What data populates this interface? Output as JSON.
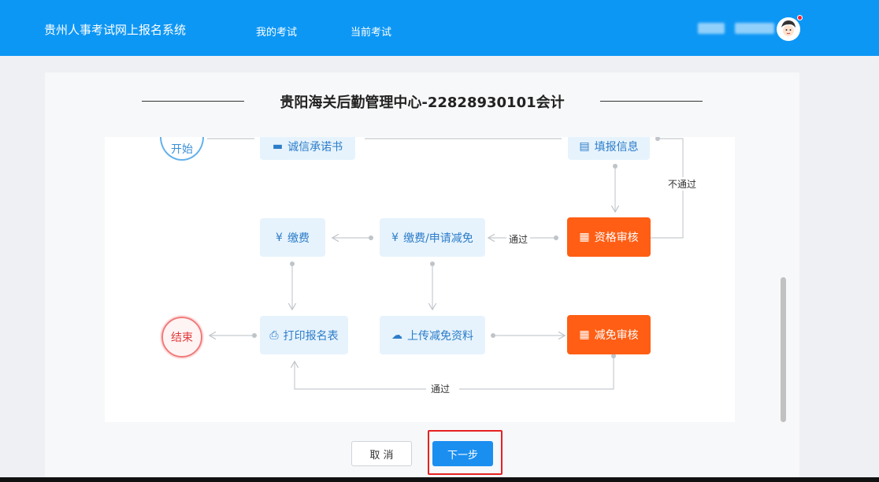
{
  "header": {
    "app_title": "贵州人事考试网上报名系统",
    "nav": [
      "我的考试",
      "当前考试"
    ]
  },
  "page": {
    "title": "贵阳海关后勤管理中心-22828930101会计"
  },
  "flow": {
    "start": "开始",
    "end": "结束",
    "steps": {
      "commitment": "诚信承诺书",
      "fill_info": "填报信息",
      "qualification_review": "资格审核",
      "pay_or_reduce": "缴费/申请减免",
      "pay": "缴费",
      "upload_reduce": "上传减免资料",
      "reduce_review": "减免审核",
      "print_form": "打印报名表"
    },
    "edge_labels": {
      "fail": "不通过",
      "pass_1": "通过",
      "pass_2": "通过"
    },
    "icons": {
      "commitment": "card-icon",
      "fill_info": "form-icon",
      "qualification_review": "document-check-icon",
      "pay_or_reduce": "yuan-icon",
      "pay": "yuan-icon",
      "upload_reduce": "cloud-upload-icon",
      "reduce_review": "document-check-icon",
      "print_form": "printer-icon"
    }
  },
  "actions": {
    "cancel": "取 消",
    "next": "下一步"
  },
  "colors": {
    "header": "#0d97f5",
    "accent_orange": "#ff5e14",
    "primary_button": "#1b8ff0",
    "highlight": "#e52222"
  }
}
